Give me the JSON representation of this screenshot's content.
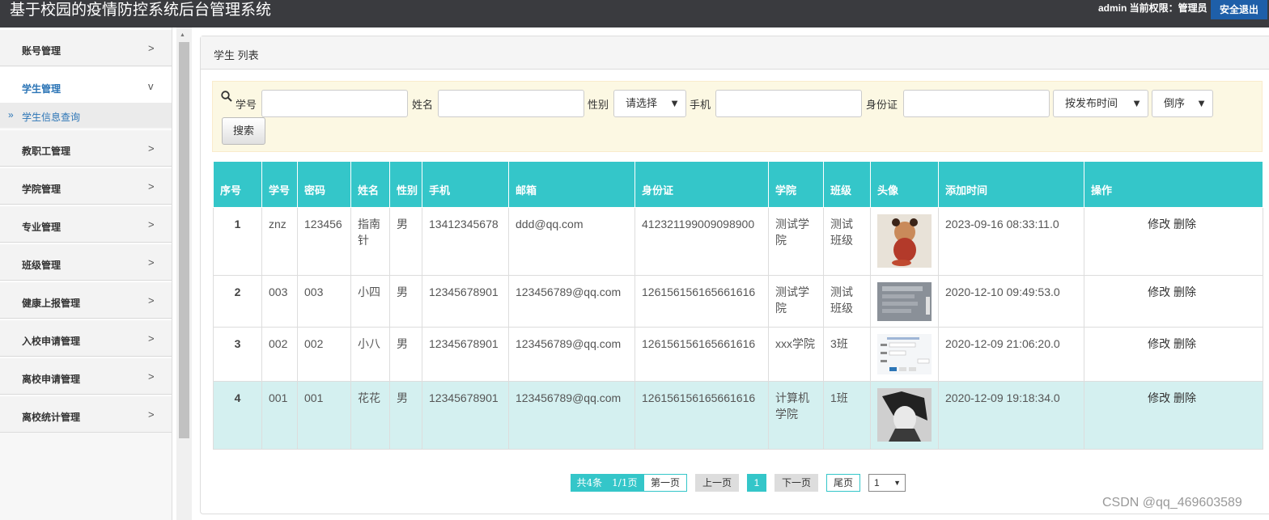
{
  "header": {
    "title": "基于校园的疫情防控系统后台管理系统",
    "user_info": "admin 当前权限：管理员",
    "logout_label": "安全退出"
  },
  "sidebar": {
    "items": [
      {
        "label": "账号管理",
        "chevron": ">"
      },
      {
        "label": "学生管理",
        "chevron": "v"
      },
      {
        "label": "教职工管理",
        "chevron": ">"
      },
      {
        "label": "学院管理",
        "chevron": ">"
      },
      {
        "label": "专业管理",
        "chevron": ">"
      },
      {
        "label": "班级管理",
        "chevron": ">"
      },
      {
        "label": "健康上报管理",
        "chevron": ">"
      },
      {
        "label": "入校申请管理",
        "chevron": ">"
      },
      {
        "label": "离校申请管理",
        "chevron": ">"
      },
      {
        "label": "离校统计管理",
        "chevron": ">"
      }
    ],
    "sub_item": {
      "marker": "»",
      "label": "学生信息查询"
    }
  },
  "panel": {
    "title": "学生 列表"
  },
  "search": {
    "student_no_label": "学号",
    "student_no_value": "",
    "name_label": "姓名",
    "name_value": "",
    "gender_label": "性别",
    "gender_selected": "请选择",
    "phone_label": "手机",
    "phone_value": "",
    "id_label": "身份证",
    "id_value": "",
    "sort_field_selected": "按发布时间",
    "sort_order_selected": "倒序",
    "search_button": "搜索"
  },
  "table": {
    "headers": {
      "idx": "序号",
      "no": "学号",
      "pwd": "密码",
      "name": "姓名",
      "gender": "性别",
      "phone": "手机",
      "email": "邮箱",
      "idcard": "身份证",
      "college": "学院",
      "class": "班级",
      "avatar": "头像",
      "added": "添加时间",
      "ops": "操作"
    },
    "edit_label": "修改",
    "delete_label": "删除",
    "rows": [
      {
        "idx": "1",
        "no": "znz",
        "pwd": "123456",
        "name": "指南针",
        "gender": "男",
        "phone": "13412345678",
        "email": "ddd@qq.com",
        "idcard": "412321199009098900",
        "college": "测试学院",
        "class": "测试班级",
        "added": "2023-09-16 08:33:11.0",
        "avatar": "cartoon-girl-avatar"
      },
      {
        "idx": "2",
        "no": "003",
        "pwd": "003",
        "name": "小四",
        "gender": "男",
        "phone": "12345678901",
        "email": "123456789@qq.com",
        "idcard": "126156156165661616",
        "college": "测试学院",
        "class": "测试班级",
        "added": "2020-12-10 09:49:53.0",
        "avatar": "form-screenshot-avatar"
      },
      {
        "idx": "3",
        "no": "002",
        "pwd": "002",
        "name": "小八",
        "gender": "男",
        "phone": "12345678901",
        "email": "123456789@qq.com",
        "idcard": "126156156165661616",
        "college": "xxx学院",
        "class": "3班",
        "added": "2020-12-09 21:06:20.0",
        "avatar": "form-screenshot-avatar"
      },
      {
        "idx": "4",
        "no": "001",
        "pwd": "001",
        "name": "花花",
        "gender": "男",
        "phone": "12345678901",
        "email": "123456789@qq.com",
        "idcard": "126156156165661616",
        "college": "计算机学院",
        "class": "1班",
        "added": "2020-12-09 19:18:34.0",
        "avatar": "anime-boy-avatar"
      }
    ]
  },
  "pager": {
    "info": "共4条　1/1页",
    "first": "第一页",
    "prev": "上一页",
    "current": "1",
    "next": "下一页",
    "last": "尾页",
    "page_select": "1"
  },
  "watermark": "CSDN @qq_469603589",
  "colors": {
    "accent": "#34c6c9",
    "topbar": "#3a3b3f",
    "logout": "#1e5fa9",
    "search_bg": "#fcf8e3",
    "highlight_row": "#d4f0f0"
  }
}
